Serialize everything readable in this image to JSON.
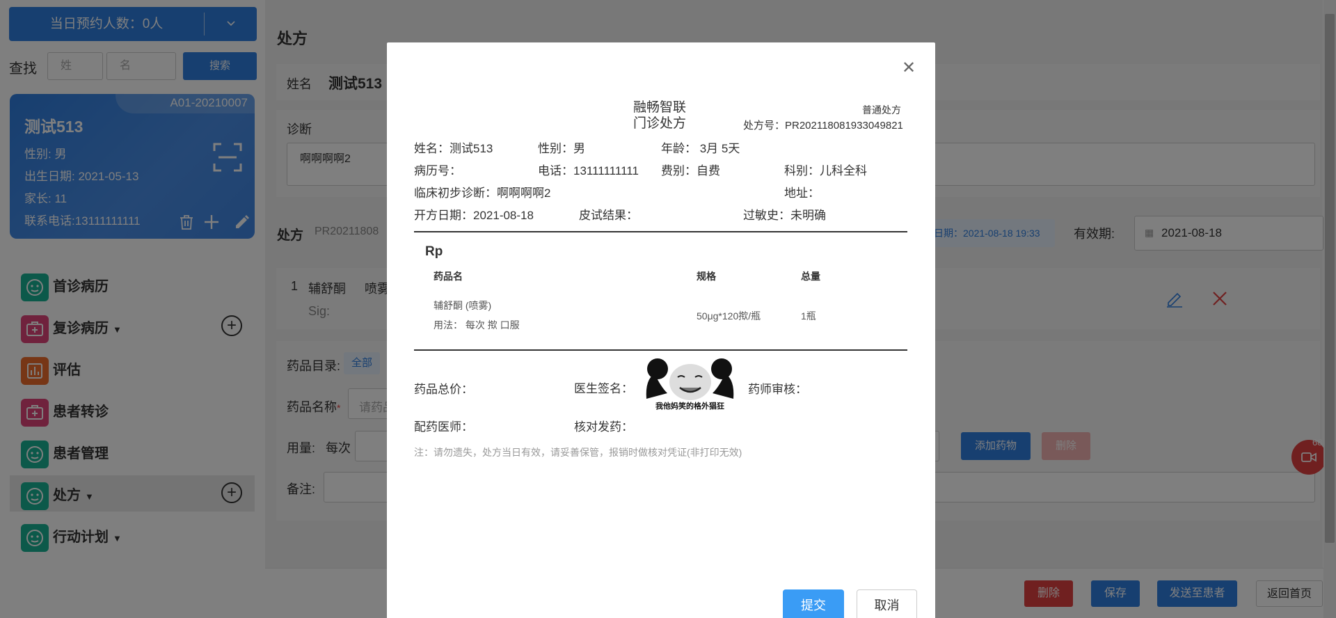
{
  "sidebar": {
    "appointments_label": "当日预约人数：0人",
    "find_label": "查找",
    "last_name_placeholder": "姓",
    "first_name_placeholder": "名",
    "search_button": "搜索",
    "patient_card": {
      "id": "A01-20210007",
      "name": "测试513",
      "gender": "性别: 男",
      "birth": "出生日期: 2021-05-13",
      "parent": "家长: 11",
      "phone": "联系电话:13111111111"
    },
    "nav": [
      {
        "label": "首诊病历",
        "icon": "medical-record-icon",
        "color": "#19b394"
      },
      {
        "label": "复诊病历",
        "icon": "medical-kit-icon",
        "color": "#e0457b"
      },
      {
        "label": "评估",
        "icon": "bar-chart-icon",
        "color": "#ef6c2d"
      },
      {
        "label": "患者转诊",
        "icon": "medical-kit-icon",
        "color": "#e0457b"
      },
      {
        "label": "患者管理",
        "icon": "medical-record-icon",
        "color": "#19b394"
      },
      {
        "label": "处方",
        "icon": "medical-record-icon",
        "color": "#19b394"
      },
      {
        "label": "行动计划",
        "icon": "medical-record-icon",
        "color": "#19b394"
      }
    ]
  },
  "main": {
    "title": "处方",
    "name_label": "姓名",
    "name_value": "测试513",
    "diagnosis_label": "诊断",
    "diagnosis_value": "啊啊啊啊2",
    "rx_label": "处方",
    "rx_no": "PR20211808",
    "open_date_tag": "日期：2021-08-18 19:33",
    "valid_label": "有效期:",
    "valid_value": "2021-08-18",
    "drug_row_no": "1",
    "drug_row_name": "辅舒酮",
    "drug_row_form": "喷雾",
    "sig_label": "Sig:",
    "catalog_label": "药品目录:",
    "catalog_all": "全部",
    "drug_name_label": "药品名称",
    "drug_name_placeholder": "请药品",
    "dose_label": "用量:",
    "dose_each": "每次",
    "add_drug_button": "添加药物",
    "delete_drug_button": "删除",
    "remark_label": "备注:",
    "float_badge": "68",
    "bottom": {
      "delete": "删除",
      "save": "保存",
      "send": "发送至患者",
      "home": "返回首页"
    }
  },
  "modal": {
    "org": "融畅智联",
    "doc_title": "门诊处方",
    "rx_type": "普通处方",
    "rx_number": "处方号：PR202118081933049821",
    "fields": {
      "name": "姓名：测试513",
      "gender": "性别：男",
      "age": "年龄：  3月 5天",
      "record_no": "病历号：",
      "phone": "电话：13111111111",
      "fee": "费别：自费",
      "dept": "科别：儿科全科",
      "diagnosis": "临床初步诊断：啊啊啊啊2",
      "address": "地址：",
      "date": "开方日期：2021-08-18",
      "skin_test": "皮试结果：",
      "allergy": "过敏史：未明确"
    },
    "rp": "Rp",
    "table": {
      "headers": [
        "药品名",
        "规格",
        "总量"
      ],
      "rows": [
        {
          "name": "辅舒酮 (喷雾)",
          "usage": "用法：  每次 揿 口服",
          "spec": "50μg*120揿/瓶",
          "qty": "1瓶"
        }
      ]
    },
    "total_label": "药品总价：",
    "doctor_sign_label": "医生签名：",
    "signature_caption": "我他妈笑的格外猖狂",
    "pharmacist_label": "药师审核：",
    "dispenser_label": "配药医师：",
    "checker_label": "核对发药：",
    "note": "注：请勿遗失，处方当日有效，请妥善保管，报销时做核对凭证(非打印无效)",
    "submit": "提交",
    "cancel": "取消"
  }
}
